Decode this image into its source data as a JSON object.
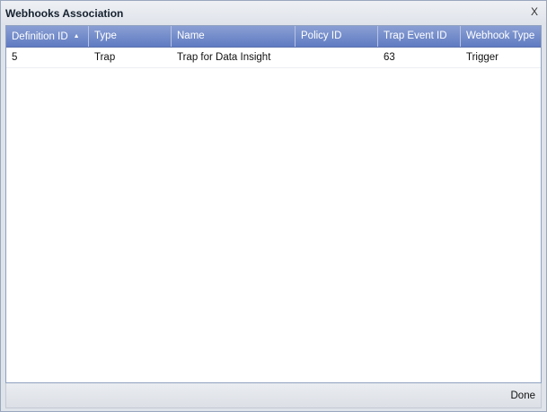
{
  "dialog": {
    "title": "Webhooks Association",
    "close_label": "X",
    "done_label": "Done"
  },
  "table": {
    "columns": [
      {
        "label": "Definition ID",
        "sorted": "ascending"
      },
      {
        "label": "Type"
      },
      {
        "label": "Name"
      },
      {
        "label": "Policy ID"
      },
      {
        "label": "Trap Event ID"
      },
      {
        "label": "Webhook Type"
      }
    ],
    "rows": [
      [
        "5",
        "Trap",
        "Trap for Data Insight",
        "",
        "63",
        "Trigger"
      ]
    ]
  },
  "icons": {
    "sort": "sort-ascending-icon"
  },
  "colors": {
    "header_top": "#8a9fd3",
    "header_bottom": "#5f7bc2",
    "dialog_bg": "#dfe3ea"
  }
}
